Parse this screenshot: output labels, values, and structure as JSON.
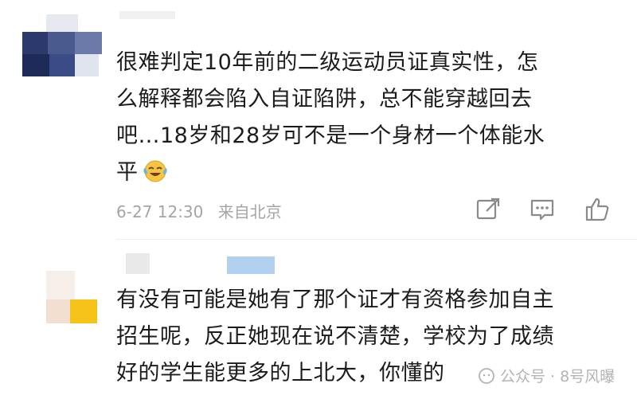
{
  "comment1": {
    "lines": [
      "很难判定10年前的二级运动员证真实性，怎",
      "么解释都会陷入自证陷阱，总不能穿越回去",
      "吧…18岁和28岁可不是一个身材一个体能水",
      "平"
    ],
    "emoji": "laugh-cry-emoji",
    "timestamp": "6-27 12:30",
    "location": "来自北京"
  },
  "comment2": {
    "lines": [
      "有没有可能是她有了那个证才有资格参加自主",
      "招生呢，反正她现在说不清楚，学校为了成绩",
      "好的学生能更多的上北大，你懂的"
    ]
  },
  "watermark": {
    "text": "公众号 · 8号风曝"
  },
  "colors": {
    "text": "#1c1c1c",
    "meta": "#a5a5a5",
    "icon": "#8a8a8a"
  }
}
